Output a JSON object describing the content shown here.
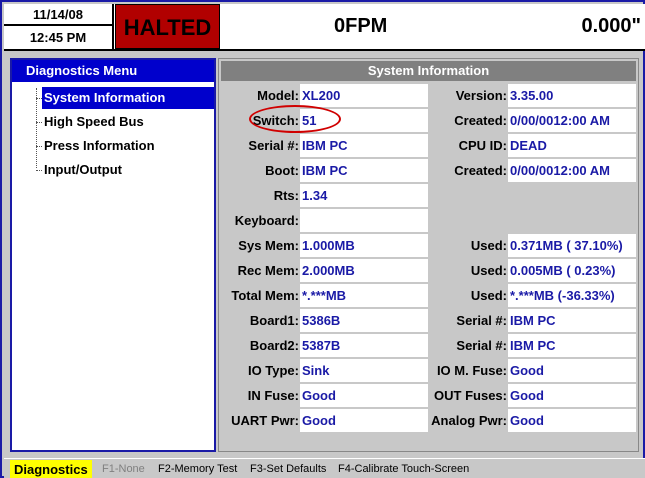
{
  "header": {
    "date": "11/14/08",
    "time": "12:45 PM",
    "status": "HALTED",
    "speed": "0FPM",
    "counter": "0.000\""
  },
  "menu": {
    "title": "Diagnostics Menu",
    "items": [
      {
        "label": "System Information",
        "selected": true
      },
      {
        "label": "High Speed Bus",
        "selected": false
      },
      {
        "label": "Press Information",
        "selected": false
      },
      {
        "label": "Input/Output",
        "selected": false
      }
    ]
  },
  "panel": {
    "title": "System Information",
    "left": [
      {
        "label": "Model:",
        "value": "XL200"
      },
      {
        "label": "Switch:",
        "value": "51"
      },
      {
        "label": "Serial #:",
        "value": "IBM PC"
      },
      {
        "label": "Boot:",
        "value": "IBM PC"
      },
      {
        "label": "Rts:",
        "value": "1.34"
      },
      {
        "label": "Keyboard:",
        "value": ""
      },
      {
        "label": "Sys Mem:",
        "value": "1.000MB"
      },
      {
        "label": "Rec Mem:",
        "value": "2.000MB"
      },
      {
        "label": "Total Mem:",
        "value": "*.***MB"
      },
      {
        "label": "Board1:",
        "value": "5386B"
      },
      {
        "label": "Board2:",
        "value": "5387B"
      },
      {
        "label": "IO Type:",
        "value": "Sink"
      },
      {
        "label": "IN Fuse:",
        "value": "Good"
      },
      {
        "label": "UART Pwr:",
        "value": "Good"
      }
    ],
    "right": [
      {
        "label": "Version:",
        "value": "3.35.00"
      },
      {
        "label": "Created:",
        "value": "0/00/0012:00 AM"
      },
      {
        "label": "CPU ID:",
        "value": "DEAD"
      },
      {
        "label": "Created:",
        "value": "0/00/0012:00 AM"
      },
      {
        "label": "",
        "value": ""
      },
      {
        "label": "",
        "value": ""
      },
      {
        "label": "Used:",
        "value": "0.371MB ( 37.10%)"
      },
      {
        "label": "Used:",
        "value": "0.005MB (  0.23%)"
      },
      {
        "label": "Used:",
        "value": "*.***MB (-36.33%)"
      },
      {
        "label": "Serial #:",
        "value": "IBM PC"
      },
      {
        "label": "Serial #:",
        "value": "IBM PC"
      },
      {
        "label": "IO M. Fuse:",
        "value": "Good"
      },
      {
        "label": "OUT Fuses:",
        "value": "Good"
      },
      {
        "label": "Analog Pwr:",
        "value": "Good"
      }
    ]
  },
  "footer": {
    "mode": "Diagnostics",
    "f1": "F1-None",
    "f2": "F2-Memory Test",
    "f3": "F3-Set Defaults",
    "f4": "F4-Calibrate Touch-Screen"
  },
  "colors": {
    "status_bg": "#b10000",
    "menu_accent": "#0000cc",
    "value_text": "#1a1aa6",
    "highlight_ring": "#d00000",
    "footer_active": "#ffff00"
  }
}
